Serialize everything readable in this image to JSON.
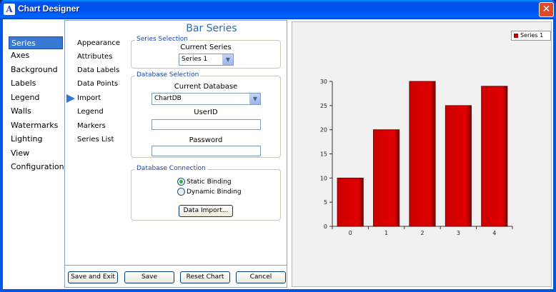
{
  "window": {
    "title": "Chart Designer",
    "icon_letter": "A",
    "close_glyph": "✕"
  },
  "nav": {
    "items": [
      {
        "label": "Series",
        "selected": true
      },
      {
        "label": "Axes"
      },
      {
        "label": "Background"
      },
      {
        "label": "Labels"
      },
      {
        "label": "Legend"
      },
      {
        "label": "Walls"
      },
      {
        "label": "Watermarks"
      },
      {
        "label": "Lighting"
      },
      {
        "label": "View"
      },
      {
        "label": "Configuration"
      }
    ]
  },
  "sub_nav": {
    "items": [
      {
        "label": "Appearance"
      },
      {
        "label": "Attributes"
      },
      {
        "label": "Data Labels"
      },
      {
        "label": "Data Points"
      },
      {
        "label": "Import",
        "current": true
      },
      {
        "label": "Legend"
      },
      {
        "label": "Markers"
      },
      {
        "label": "Series List"
      }
    ]
  },
  "panel": {
    "title": "Bar Series",
    "series_selection": {
      "legend": "Series Selection",
      "label": "Current Series",
      "value": "Series 1"
    },
    "database_selection": {
      "legend": "Database Selection",
      "db_label": "Current Database",
      "db_value": "ChartDB",
      "userid_label": "UserID",
      "userid_value": "",
      "password_label": "Password",
      "password_value": ""
    },
    "database_connection": {
      "legend": "Database Connection",
      "static_label": "Static Binding",
      "dynamic_label": "Dynamic Binding",
      "selected": "Static Binding",
      "import_button": "Data Import..."
    }
  },
  "buttons": {
    "save_exit": "Save and Exit",
    "save": "Save",
    "reset": "Reset Chart",
    "cancel": "Cancel"
  },
  "colors": {
    "bar": "#cc0000",
    "bar_dark": "#7a0000",
    "accent": "#2e6bb8"
  },
  "chart_data": {
    "type": "bar",
    "categories": [
      "0",
      "1",
      "2",
      "3",
      "4"
    ],
    "series": [
      {
        "name": "Series 1",
        "values": [
          10,
          20,
          30,
          25,
          29
        ]
      }
    ],
    "ylim": [
      0,
      30
    ],
    "yticks": [
      0,
      5,
      10,
      15,
      20,
      25,
      30
    ],
    "grid": false,
    "legend": "top-right"
  }
}
